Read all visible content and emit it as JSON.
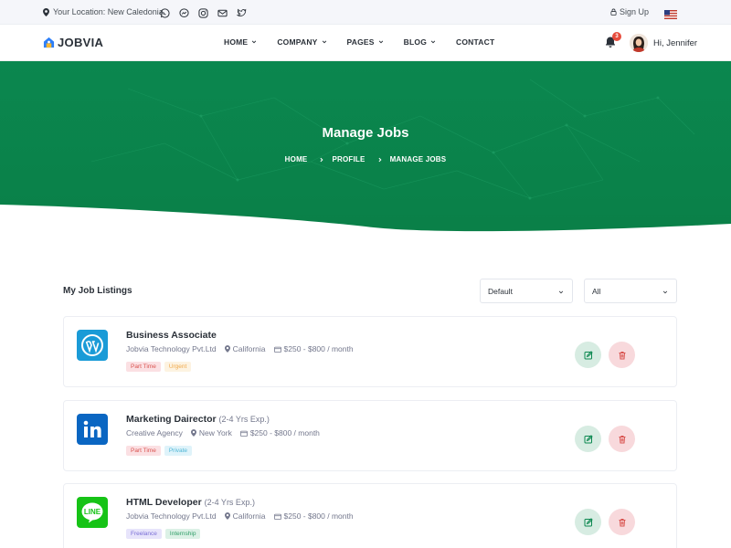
{
  "topbar": {
    "location": "Your Location: New Caledonia",
    "signup": "Sign Up",
    "social_icons": [
      "whatsapp-icon",
      "messenger-icon",
      "instagram-icon",
      "envelope-icon",
      "twitter-icon"
    ]
  },
  "navbar": {
    "brand": "JOBVIA",
    "menu": [
      "HOME",
      "COMPANY",
      "PAGES",
      "BLOG",
      "CONTACT"
    ],
    "notifications": "3",
    "greeting": "Hi, Jennifer"
  },
  "hero": {
    "title": "Manage Jobs",
    "breadcrumb": [
      "HOME",
      "PROFILE",
      "MANAGE JOBS"
    ]
  },
  "listing": {
    "title": "My Job Listings",
    "sort_select": "Default",
    "filter_select": "All"
  },
  "jobs": [
    {
      "title": "Business Associate",
      "experience": "",
      "company": "Jobvia Technology Pvt.Ltd",
      "location": "California",
      "salary": "$250 - $800 / month",
      "logo": "wordpress-icon",
      "tags": [
        "Part Time",
        "Urgent"
      ]
    },
    {
      "title": "Marketing Dairector",
      "experience": "(2-4 Yrs Exp.)",
      "company": "Creative Agency",
      "location": "New York",
      "salary": "$250 - $800 / month",
      "logo": "linkedin-icon",
      "tags": [
        "Part Time",
        "Private"
      ]
    },
    {
      "title": "HTML Developer",
      "experience": "(2-4 Yrs Exp.)",
      "company": "Jobvia Technology Pvt.Ltd",
      "location": "California",
      "salary": "$250 - $800 / month",
      "logo": "line-icon",
      "tags": [
        "Freelance",
        "Internship"
      ]
    }
  ],
  "colors": {
    "primary": "#0c8850",
    "hero_bg": "#0c8850",
    "danger": "#e74c3c",
    "text": "#2b3139"
  }
}
